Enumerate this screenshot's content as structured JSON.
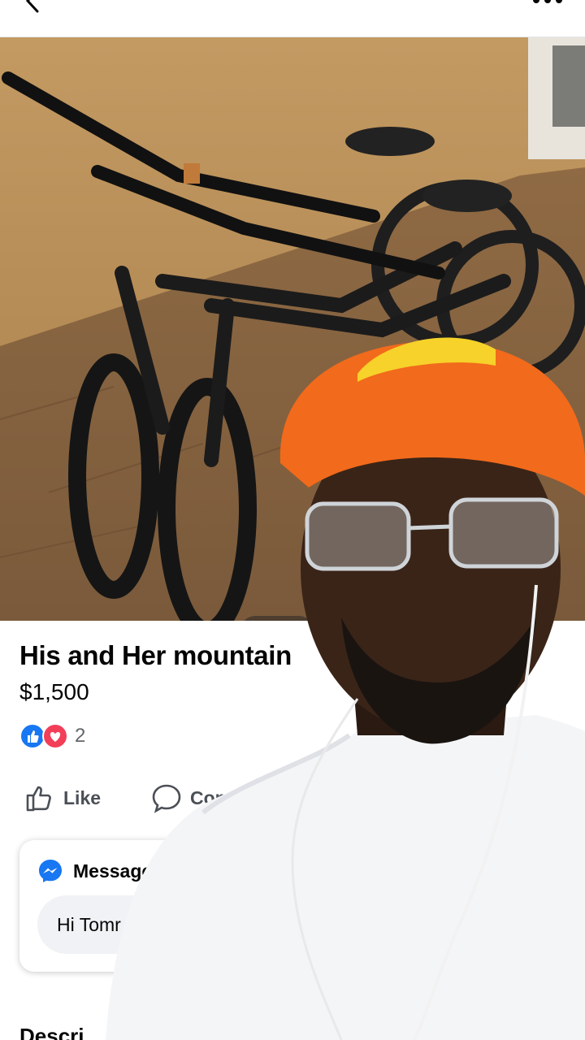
{
  "header": {
    "back_icon": "chevron-left-icon",
    "more_icon": "more-dots-icon"
  },
  "photo": {
    "subject": "two mountain bikes against a stucco wall",
    "pager_dot_count": 4,
    "active_dot_index": 0
  },
  "listing": {
    "title": "His and Her mountain",
    "price": "$1,500",
    "reaction_count": "2",
    "reaction_icons": [
      "like-reaction-icon",
      "love-reaction-icon"
    ]
  },
  "actions": {
    "like_label": "Like",
    "comment_label": "Commen"
  },
  "message_card": {
    "heading": "Message s",
    "input_value": "Hi Tomr"
  },
  "description": {
    "heading": "Descri"
  },
  "colors": {
    "facebook_blue": "#1877f2",
    "love_red": "#f33e58",
    "muted_text": "#65676b",
    "input_bg": "#f0f2f5"
  }
}
